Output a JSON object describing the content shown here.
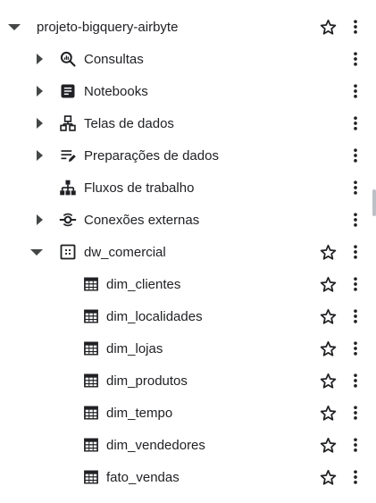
{
  "project": {
    "name": "projeto-bigquery-airbyte",
    "expanded": true,
    "starred": false
  },
  "sections": [
    {
      "label": "Consultas",
      "icon": "query-icon"
    },
    {
      "label": "Notebooks",
      "icon": "notebook-icon"
    },
    {
      "label": "Telas de dados",
      "icon": "data-canvas-icon"
    },
    {
      "label": "Preparações de dados",
      "icon": "data-preparation-icon"
    },
    {
      "label": "Fluxos de trabalho",
      "icon": "workflow-icon"
    },
    {
      "label": "Conexões externas",
      "icon": "external-connection-icon"
    }
  ],
  "dataset": {
    "name": "dw_comercial",
    "expanded": true,
    "icon": "dataset-icon"
  },
  "tables": [
    {
      "name": "dim_clientes"
    },
    {
      "name": "dim_localidades"
    },
    {
      "name": "dim_lojas"
    },
    {
      "name": "dim_produtos"
    },
    {
      "name": "dim_tempo"
    },
    {
      "name": "dim_vendedores"
    },
    {
      "name": "fato_vendas"
    }
  ],
  "colors": {
    "icon": "#202124",
    "chevron": "#444746",
    "text": "#202124"
  }
}
